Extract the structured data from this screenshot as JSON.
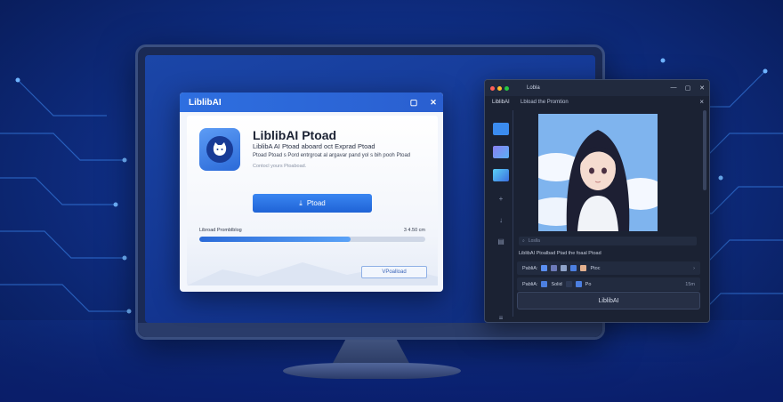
{
  "installer": {
    "window_title": "LiblibAI",
    "app_name": "LiblibAI Ptoad",
    "app_subtitle": "LiblibA AI Ptoad aboard oct Exprad Ptoad",
    "app_description": "Ptoad Ptoad s Pord entrgroat al argavar pand yol s bih pooh Ptoad",
    "app_note": "Contocl yours Ptoaboad.",
    "install_button_label": "Ptoad",
    "progress_label": "Libroad Promblblog",
    "progress_size": "3 4.50 cm",
    "progress_fraction": 0.67,
    "secondary_button_label": "VPoalload",
    "accent_color": "#2a6ad8"
  },
  "app_window": {
    "title": "Lobla",
    "brand": "LiblibAI",
    "heading": "Lbload the Promtion",
    "search_placeholder": "Loslla",
    "caption": "LiblibAI Ptoalbad Ptad the foaal Ptoad",
    "row1": {
      "label": "PabliA:",
      "end_text": "Ptoc"
    },
    "row2": {
      "label": "PabliA:",
      "item_text": "Solid",
      "item2": "Po",
      "end_text": "15m"
    },
    "footer_button_label": "LiblibAI"
  },
  "icons": [
    "download-icon",
    "cat-logo-icon",
    "minimize-icon",
    "maximize-icon",
    "close-icon",
    "search-icon"
  ]
}
